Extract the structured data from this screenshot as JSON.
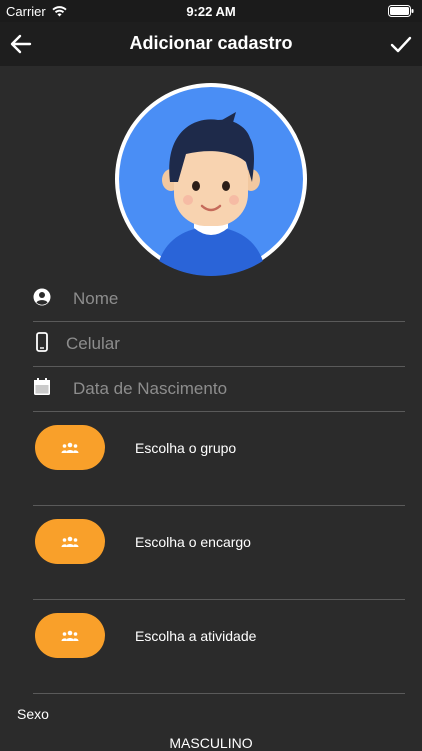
{
  "status_bar": {
    "carrier": "Carrier",
    "time": "9:22 AM"
  },
  "nav": {
    "title": "Adicionar cadastro",
    "back_icon": "arrow-left-icon",
    "confirm_icon": "check-icon"
  },
  "avatar": {
    "icon": "user-avatar-icon",
    "bg_color": "#4a8ef5"
  },
  "form": {
    "name_placeholder": "Nome",
    "phone_placeholder": "Celular",
    "birthdate_placeholder": "Data de Nascimento"
  },
  "choosers": [
    {
      "label": "Escolha o grupo",
      "icon": "group-icon"
    },
    {
      "label": "Escolha o encargo",
      "icon": "group-icon"
    },
    {
      "label": "Escolha a atividade",
      "icon": "group-icon"
    }
  ],
  "sexo": {
    "label": "Sexo",
    "value": "MASCULINO"
  },
  "colors": {
    "accent": "#f9a02a",
    "background": "#2b2b2b",
    "navbar": "#1e1e1e"
  }
}
